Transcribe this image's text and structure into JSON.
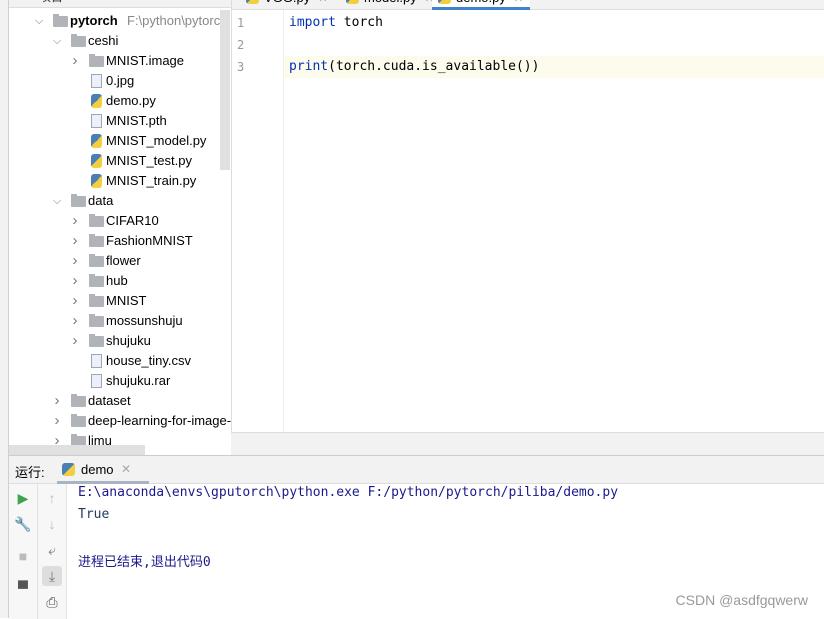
{
  "project_panel": {
    "title": "项目",
    "root": {
      "name": "pytorch",
      "path": "F:\\python\\pytorch"
    },
    "tree": [
      {
        "label": "ceshi",
        "type": "folder",
        "depth": 1,
        "expanded": true
      },
      {
        "label": "MNIST.image",
        "type": "folder",
        "depth": 2,
        "expanded": false
      },
      {
        "label": "0.jpg",
        "type": "image",
        "depth": 2
      },
      {
        "label": "demo.py",
        "type": "python",
        "depth": 2
      },
      {
        "label": "MNIST.pth",
        "type": "file",
        "depth": 2
      },
      {
        "label": "MNIST_model.py",
        "type": "python",
        "depth": 2
      },
      {
        "label": "MNIST_test.py",
        "type": "python",
        "depth": 2
      },
      {
        "label": "MNIST_train.py",
        "type": "python",
        "depth": 2
      },
      {
        "label": "data",
        "type": "folder",
        "depth": 1,
        "expanded": true
      },
      {
        "label": "CIFAR10",
        "type": "folder",
        "depth": 2,
        "expanded": false
      },
      {
        "label": "FashionMNIST",
        "type": "folder",
        "depth": 2,
        "expanded": false
      },
      {
        "label": "flower",
        "type": "folder",
        "depth": 2,
        "expanded": false
      },
      {
        "label": "hub",
        "type": "folder",
        "depth": 2,
        "expanded": false
      },
      {
        "label": "MNIST",
        "type": "folder",
        "depth": 2,
        "expanded": false
      },
      {
        "label": "mossunshuju",
        "type": "folder",
        "depth": 2,
        "expanded": false
      },
      {
        "label": "shujuku",
        "type": "folder",
        "depth": 2,
        "expanded": false
      },
      {
        "label": "house_tiny.csv",
        "type": "file",
        "depth": 2
      },
      {
        "label": "shujuku.rar",
        "type": "unknown",
        "depth": 2
      },
      {
        "label": "dataset",
        "type": "folder",
        "depth": 1,
        "expanded": false
      },
      {
        "label": "deep-learning-for-image-pr",
        "type": "folder",
        "depth": 1,
        "expanded": false
      },
      {
        "label": "limu",
        "type": "folder",
        "depth": 1,
        "expanded": false
      }
    ]
  },
  "editor": {
    "tabs": [
      {
        "label": "VGG.py",
        "active": false
      },
      {
        "label": "model.py",
        "active": false
      },
      {
        "label": "demo.py",
        "active": true
      }
    ],
    "lines": [
      {
        "num": "1",
        "kw": "import",
        "rest": " torch"
      },
      {
        "num": "2",
        "kw": "",
        "rest": ""
      },
      {
        "num": "3",
        "kw": "print",
        "rest": "(torch.cuda.is_available())"
      }
    ]
  },
  "run_panel": {
    "label": "运行:",
    "tab": "demo",
    "output": [
      "E:\\anaconda\\envs\\gputorch\\python.exe F:/python/pytorch/piliba/demo.py",
      "True",
      "",
      "进程已结束,退出代码0"
    ]
  },
  "watermark": "CSDN @asdfgqwerw",
  "colors": {
    "accent": "#4083c9",
    "keyword": "#0033b3",
    "console": "#1a1a8c",
    "run": "#3fa34d"
  }
}
